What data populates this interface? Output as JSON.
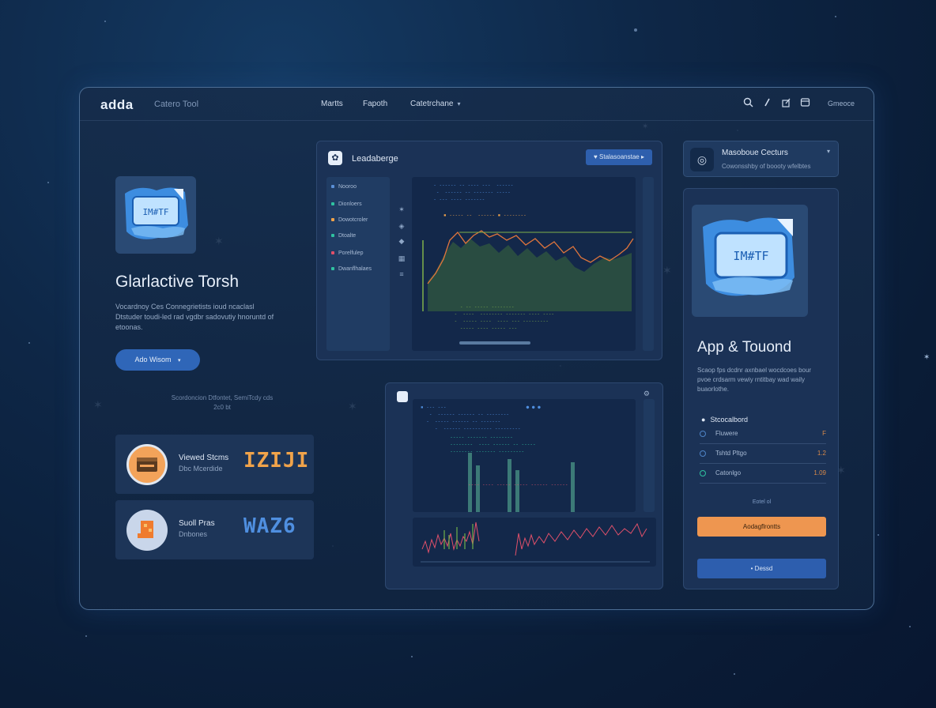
{
  "header": {
    "brand": "adda",
    "brand_sub": "Catero Tool",
    "nav": [
      "Martts",
      "Fapoth",
      "Catetrchane"
    ],
    "user": "Gmeoce"
  },
  "hero": {
    "icon_text": "IM#TF",
    "title": "Glarlactive Torsh",
    "description": "Vocardnoy Ces Connegrietists ioud ncaclasl Dtstuder toudi-led rad vgdbr sadovutiy hnoruntd of etoonas.",
    "button_label": "Ado Wisom",
    "caption": "Scordoncion Dtfontet, SemiTcdy cds 2c0 bt"
  },
  "stats": [
    {
      "title": "Viewed Stcms",
      "subtitle": "Dbc Mcerdide",
      "value": "IZIJI",
      "color": "#f0a34a"
    },
    {
      "title": "Suoll Pras",
      "subtitle": "Dnbones",
      "value": "WAZ6",
      "color": "#4f8fe0"
    }
  ],
  "panel_main": {
    "title": "Leadaberge",
    "action_label": "Stalasoanstae",
    "sidebar": [
      "Nooroo",
      "Dionloers",
      "Dowotcroler",
      "Dtoalte",
      "Porelfulep",
      "Dwanflhalaes"
    ]
  },
  "dropdown": {
    "title": "Masoboue Cecturs",
    "subtitle": "Cowonsshby of boooty wfelbtes"
  },
  "app_panel": {
    "image_text": "IM#TF",
    "title": "App & Touond",
    "description": "Scaop fps dcdnr axnbael wocdcoes bour pvoe crdsarm vewiy rntitbay wad waily buaorlothe.",
    "section_head": "Stcocalbord",
    "rows": [
      {
        "label": "Fluwere",
        "value": "F"
      },
      {
        "label": "Tshtd Pltgo",
        "value": "1.2"
      },
      {
        "label": "Catonlgo",
        "value": "1.09"
      }
    ],
    "link": "Eotel ol",
    "primary_button": "Aodagflrontts",
    "secondary_button": "• Dessd"
  },
  "colors": {
    "accent": "#2f66b8",
    "orange": "#ee9650",
    "panel": "#1b3256"
  }
}
